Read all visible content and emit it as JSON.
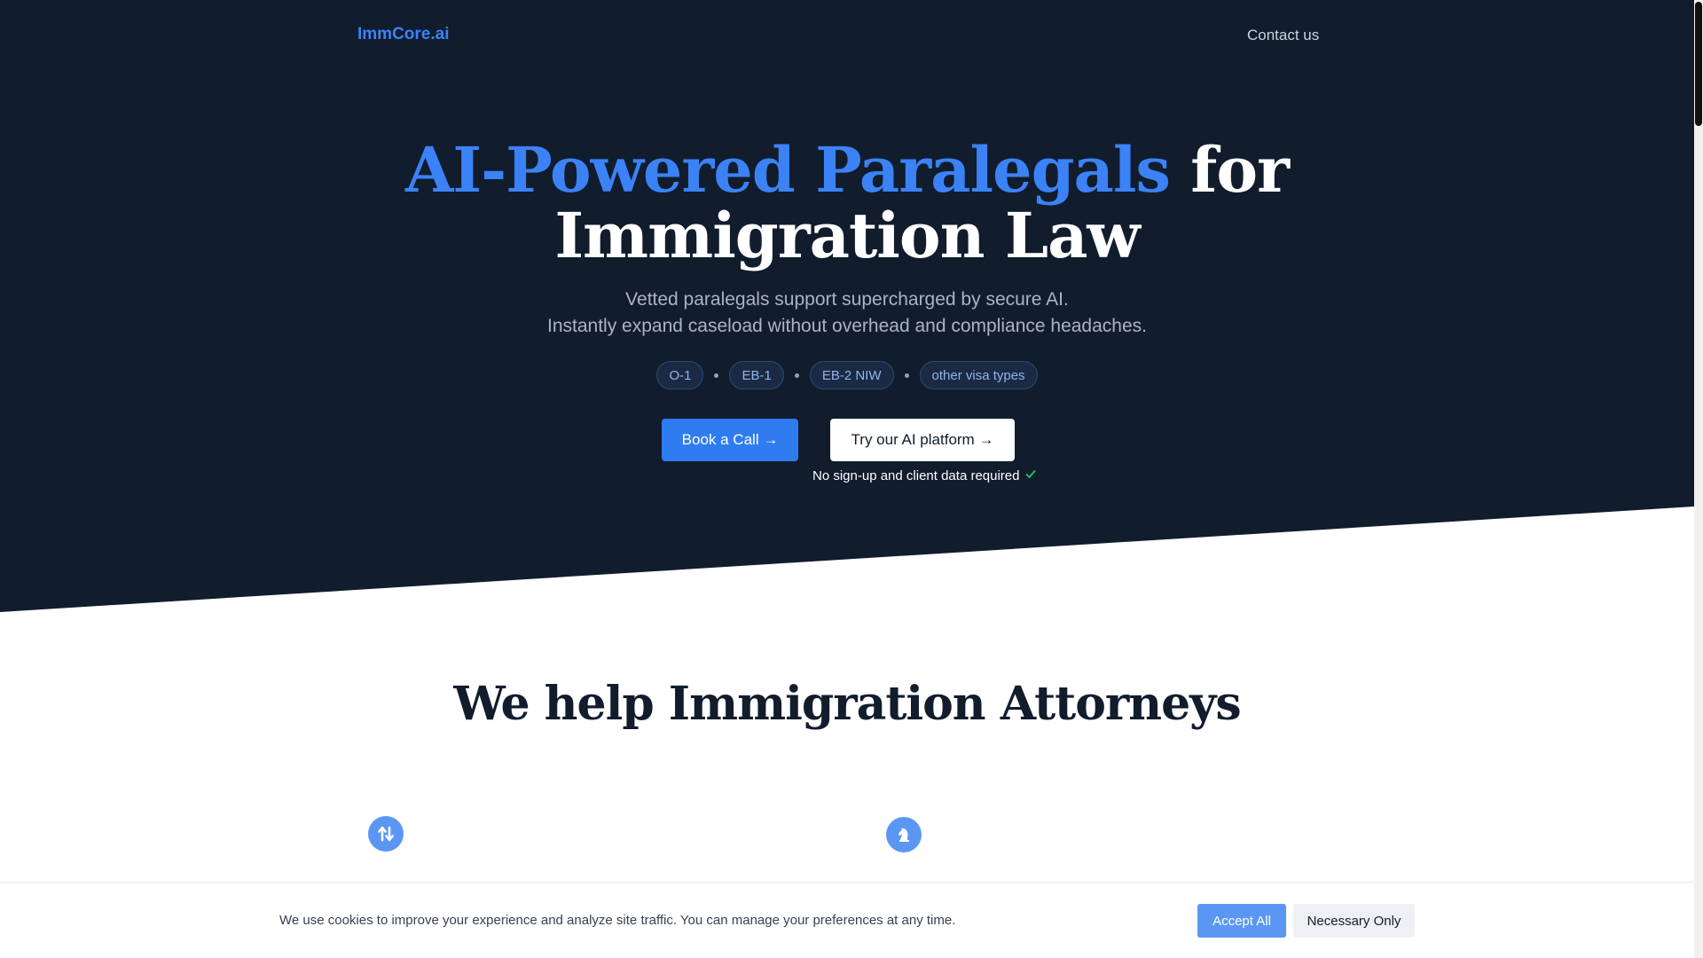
{
  "nav": {
    "logo": "ImmCore.ai",
    "contact": "Contact us"
  },
  "hero": {
    "headline_accent": "AI-Powered Paralegals",
    "headline_rest_1": " for",
    "headline_rest_2": "Immigration Law",
    "subline_1": "Vetted paralegals support supercharged by secure AI.",
    "subline_2": "Instantly expand caseload without overhead and compliance headaches.",
    "tags": [
      "O-1",
      "EB-1",
      "EB-2 NIW",
      "other visa types"
    ],
    "primary_button": "Book a Call →",
    "secondary_button": "Try our AI platform →",
    "note": "No sign-up and client data required",
    "note_icon": "check-icon",
    "colors": {
      "background": "#111c2d",
      "accent": "#3b82f6",
      "check": "#22c55e"
    }
  },
  "section": {
    "title": "We help Immigration Attorneys",
    "feature_icons": [
      "arrows-up-down-icon",
      "chess-knight-icon"
    ]
  },
  "cookie_banner": {
    "text": "We use cookies to improve your experience and analyze site traffic. You can manage your preferences at any time.",
    "accept_button": "Accept All",
    "necessary_button": "Necessary Only"
  }
}
